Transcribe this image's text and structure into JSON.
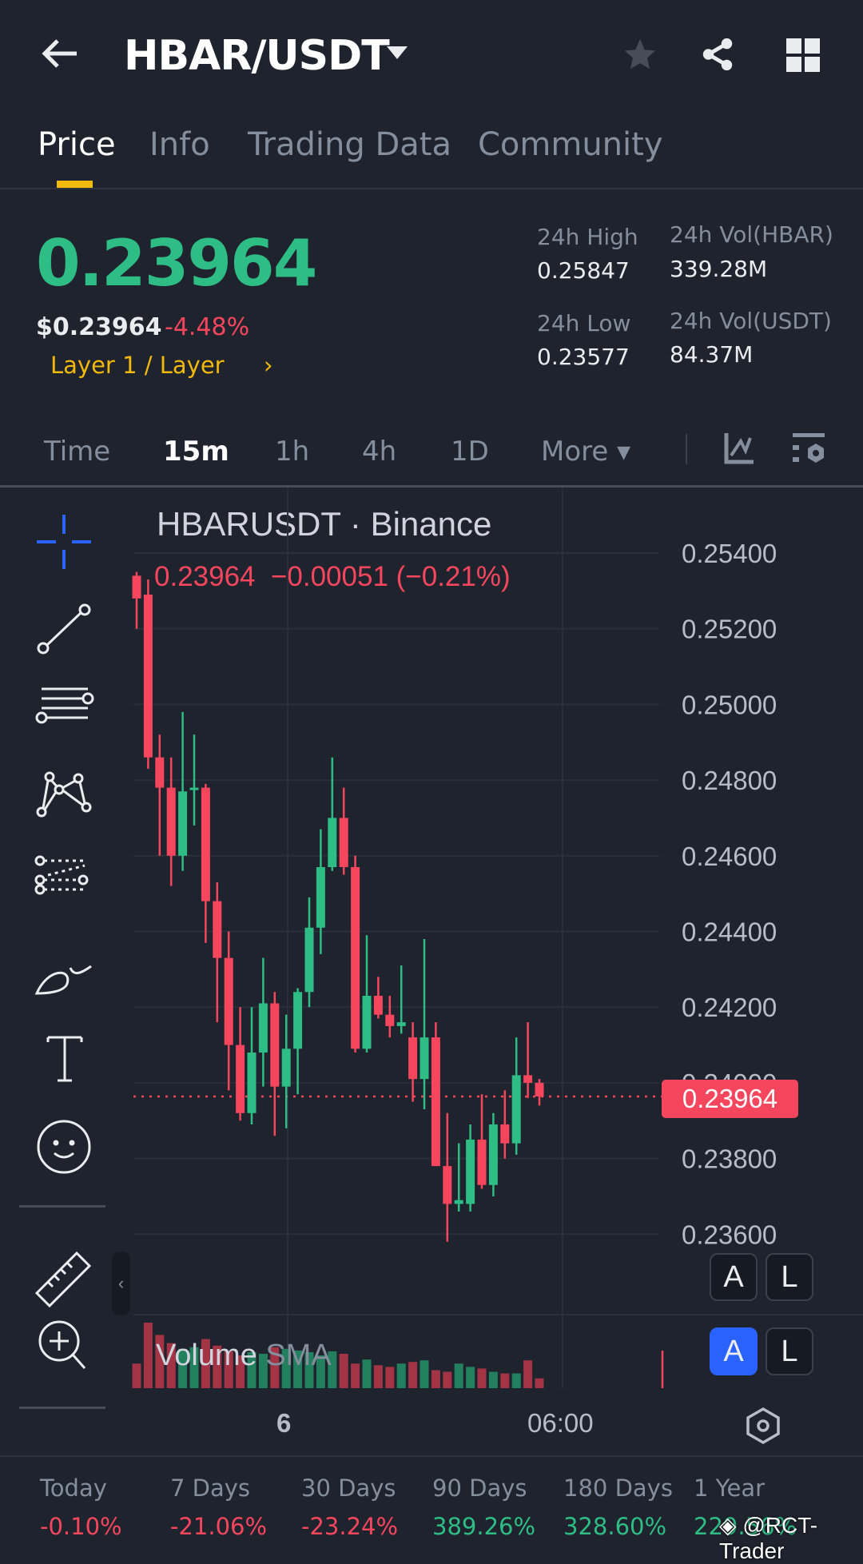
{
  "header": {
    "title": "HBAR/USDT"
  },
  "tabs": [
    {
      "label": "Price"
    },
    {
      "label": "Info"
    },
    {
      "label": "Trading Data"
    },
    {
      "label": "Community"
    }
  ],
  "price": {
    "last": "0.23964",
    "usd": "$0.23964",
    "change": "-4.48%",
    "category": "Layer 1 / Layer"
  },
  "stats": {
    "high_label": "24h High",
    "high": "0.25847",
    "low_label": "24h Low",
    "low": "0.23577",
    "vol_base_label": "24h Vol(HBAR)",
    "vol_base": "339.28M",
    "vol_quote_label": "24h Vol(USDT)",
    "vol_quote": "84.37M"
  },
  "intervals": [
    {
      "label": "Time"
    },
    {
      "label": "15m"
    },
    {
      "label": "1h"
    },
    {
      "label": "4h"
    },
    {
      "label": "1D"
    },
    {
      "label": "More"
    }
  ],
  "chart": {
    "symbol": "HBARUSDT · Binance",
    "ohlc_line": "0.23964  −0.00051 (−0.21%)",
    "current_price_tag": "0.23964",
    "volume_label": "Volume",
    "volume_sma": "SMA",
    "btn_a": "A",
    "btn_l": "L",
    "x_labels": [
      "6",
      "06:00"
    ]
  },
  "colors": {
    "up": "#2EBD85",
    "down": "#F6465D",
    "accent": "#F0B90B",
    "blue": "#2962FF"
  },
  "chart_data": {
    "type": "candlestick",
    "title": "HBARUSDT · Binance",
    "interval": "15m",
    "ylim": [
      0.2358,
      0.2548
    ],
    "y_ticks": [
      "0.25400",
      "0.25200",
      "0.25000",
      "0.24800",
      "0.24600",
      "0.24400",
      "0.24200",
      "0.24000",
      "0.23800",
      "0.23600"
    ],
    "y_tick_values": [
      0.254,
      0.252,
      0.25,
      0.248,
      0.246,
      0.244,
      0.242,
      0.24,
      0.238,
      0.236
    ],
    "candles": [
      [
        0.2534,
        0.2535,
        0.252,
        0.2528
      ],
      [
        0.2529,
        0.2533,
        0.2483,
        0.2486
      ],
      [
        0.2486,
        0.2492,
        0.246,
        0.2478
      ],
      [
        0.2478,
        0.2486,
        0.2452,
        0.246
      ],
      [
        0.246,
        0.2498,
        0.2456,
        0.2477
      ],
      [
        0.2478,
        0.2492,
        0.2468,
        0.2478
      ],
      [
        0.2478,
        0.2479,
        0.2437,
        0.2448
      ],
      [
        0.2448,
        0.2453,
        0.2416,
        0.2433
      ],
      [
        0.2433,
        0.244,
        0.2398,
        0.241
      ],
      [
        0.241,
        0.242,
        0.239,
        0.2392
      ],
      [
        0.2392,
        0.242,
        0.2389,
        0.2408
      ],
      [
        0.2408,
        0.2433,
        0.2399,
        0.2421
      ],
      [
        0.2421,
        0.2424,
        0.2386,
        0.2399
      ],
      [
        0.2399,
        0.2418,
        0.2388,
        0.2409
      ],
      [
        0.2409,
        0.2425,
        0.2397,
        0.2424
      ],
      [
        0.2424,
        0.2449,
        0.242,
        0.2441
      ],
      [
        0.2441,
        0.2467,
        0.2434,
        0.2457
      ],
      [
        0.2457,
        0.2486,
        0.2456,
        0.247
      ],
      [
        0.247,
        0.2478,
        0.2455,
        0.2457
      ],
      [
        0.2457,
        0.246,
        0.2408,
        0.2409
      ],
      [
        0.2409,
        0.2439,
        0.2408,
        0.2423
      ],
      [
        0.2423,
        0.2428,
        0.2417,
        0.2418
      ],
      [
        0.2418,
        0.2423,
        0.2412,
        0.2415
      ],
      [
        0.2415,
        0.2431,
        0.2413,
        0.2416
      ],
      [
        0.2412,
        0.2416,
        0.2395,
        0.2401
      ],
      [
        0.2401,
        0.2438,
        0.2393,
        0.2412
      ],
      [
        0.2412,
        0.2416,
        0.2378,
        0.2378
      ],
      [
        0.2378,
        0.2392,
        0.2358,
        0.2368
      ],
      [
        0.2368,
        0.2384,
        0.2366,
        0.2369
      ],
      [
        0.2368,
        0.2389,
        0.2366,
        0.2385
      ],
      [
        0.2385,
        0.2397,
        0.2372,
        0.2373
      ],
      [
        0.2373,
        0.2392,
        0.237,
        0.2389
      ],
      [
        0.2389,
        0.2398,
        0.238,
        0.2384
      ],
      [
        0.2384,
        0.2412,
        0.2381,
        0.2402
      ],
      [
        0.2402,
        0.2416,
        0.2396,
        0.24
      ],
      [
        0.24,
        0.2401,
        0.2394,
        0.23964
      ]
    ],
    "volume": [
      30,
      80,
      65,
      55,
      48,
      50,
      60,
      52,
      45,
      40,
      44,
      42,
      50,
      48,
      46,
      44,
      40,
      45,
      42,
      30,
      35,
      28,
      26,
      30,
      32,
      34,
      22,
      20,
      30,
      26,
      24,
      20,
      18,
      18,
      34,
      12
    ]
  },
  "performance": [
    {
      "label": "Today",
      "value": "-0.10%",
      "dir": "down"
    },
    {
      "label": "7 Days",
      "value": "-21.06%",
      "dir": "down"
    },
    {
      "label": "30 Days",
      "value": "-23.24%",
      "dir": "down"
    },
    {
      "label": "90 Days",
      "value": "389.26%",
      "dir": "up"
    },
    {
      "label": "180 Days",
      "value": "328.60%",
      "dir": "up"
    },
    {
      "label": "1 Year",
      "value": "229.56%",
      "dir": "up"
    }
  ],
  "watermark": "@RCT-Trader"
}
